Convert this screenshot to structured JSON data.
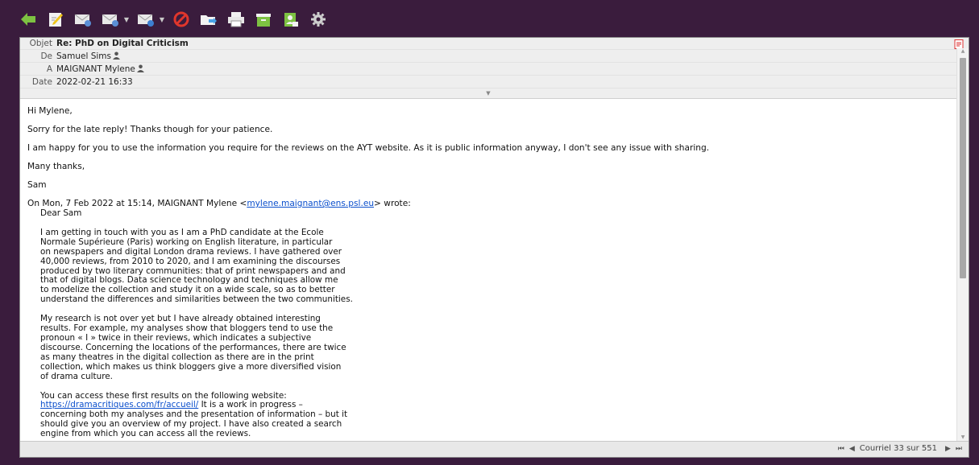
{
  "toolbar": {
    "items": [
      {
        "name": "back-icon",
        "color": "#7dc242"
      },
      {
        "name": "compose-icon",
        "color": "#e8e8e8"
      },
      {
        "name": "reply-icon",
        "color": "#e8e8e8"
      },
      {
        "name": "reply-all-icon",
        "color": "#e8e8e8"
      },
      {
        "name": "forward-icon",
        "color": "#e8e8e8"
      },
      {
        "name": "delete-icon",
        "color": "#e0362c"
      },
      {
        "name": "move-icon",
        "color": "#4aa3e8"
      },
      {
        "name": "print-icon",
        "color": "#e8e8e8"
      },
      {
        "name": "archive-icon",
        "color": "#7dc242"
      },
      {
        "name": "contact-icon",
        "color": "#7dc242"
      },
      {
        "name": "settings-icon",
        "color": "#cfcfcf"
      }
    ]
  },
  "headers": {
    "subject_label": "Objet",
    "subject": "Re: PhD on Digital Criticism",
    "from_label": "De",
    "from": "Samuel Sims",
    "to_label": "A",
    "to": "MAIGNANT Mylene",
    "date_label": "Date",
    "date": "2022-02-21 16:33"
  },
  "body": {
    "greeting": "Hi Mylene,",
    "p1": "Sorry for the late reply! Thanks though for your patience.",
    "p2": "I am happy for you to use the information you require for the reviews on the AYT website. As it is public information anyway, I don't see any issue with sharing.",
    "p3": "Many thanks,",
    "signature": "Sam",
    "quote_intro_before": "On Mon, 7 Feb 2022 at 15:14, MAIGNANT Mylene <",
    "quote_email": "mylene.maignant@ens.psl.eu",
    "quote_intro_after": "> wrote:",
    "quote_greeting": "Dear Sam",
    "quote_p1": "I am getting in touch with you as I am a PhD candidate at the Ecole\nNormale Supérieure (Paris) working on English literature, in particular\non newspapers and digital London drama reviews. I have gathered over\n40,000 reviews, from 2010 to 2020, and I am examining the discourses\nproduced by two literary communities: that of print newspapers and and\nthat of digital blogs. Data science technology and techniques allow me\nto modelize the collection and study it on a wide scale, so as to better\nunderstand the differences and similarities between the two communities.",
    "quote_p2": "My research is not over yet but I have already obtained interesting\nresults. For example, my analyses show that bloggers tend to use the\npronoun « I » twice in their reviews, which indicates a subjective\ndiscourse. Concerning the locations of the performances, there are twice\nas many theatres in the digital collection as there are in the print\ncollection, which makes us think bloggers give a more diversified vision\nof drama culture.",
    "quote_p3_line1": "You can access these first results on the following website:",
    "quote_link": "https://dramacritiques.com/fr/accueil/",
    "quote_p3_after_link": " It is a work in progress –",
    "quote_p3_rest": "concerning both my analyses and the presentation of information – but it\nshould give you an overview of my project. I have also created a search\nengine from which you can access all the reviews."
  },
  "pager": {
    "text": "Courriel 33 sur 551"
  }
}
